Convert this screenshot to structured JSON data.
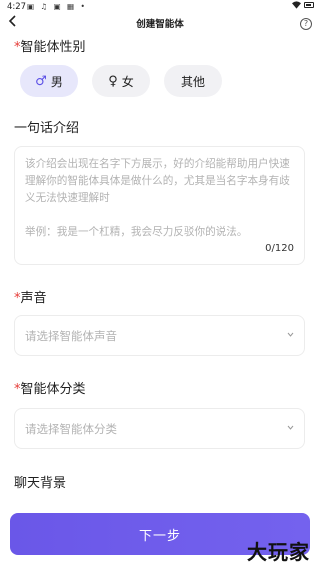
{
  "status": {
    "time": "4:27",
    "icons": "▣ ♫ ▣ ▦ •"
  },
  "header": {
    "title": "创建智能体",
    "help": "?"
  },
  "gender": {
    "label": "智能体性别",
    "options": [
      {
        "label": "男",
        "icon": "♂",
        "selected": true
      },
      {
        "label": "女",
        "icon": "♀",
        "selected": false
      },
      {
        "label": "其他",
        "icon": "",
        "selected": false
      }
    ]
  },
  "intro": {
    "label": "一句话介绍",
    "placeholder": "该介绍会出现在名字下方展示，好的介绍能帮助用户快速理解你的智能体具体是做什么的，尤其是当名字本身有歧义无法快速理解时",
    "example": "举例：我是一个杠精，我会尽力反驳你的说法。",
    "counter": "0/120"
  },
  "voice": {
    "label": "声音",
    "placeholder": "请选择智能体声音"
  },
  "category": {
    "label": "智能体分类",
    "placeholder": "请选择智能体分类"
  },
  "background": {
    "label": "聊天背景"
  },
  "next_button": "下一步",
  "watermark": "大玩家",
  "colors": {
    "accent": "#6c5ce7",
    "required": "#e53935"
  }
}
